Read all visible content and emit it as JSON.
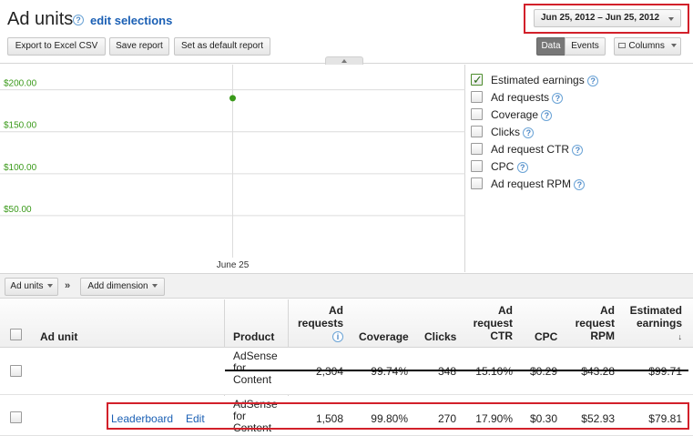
{
  "header": {
    "title": "Ad units",
    "edit_selections": "edit selections",
    "date_range": "Jun 25, 2012 – Jun 25, 2012"
  },
  "toolbar": {
    "export_label": "Export to Excel CSV",
    "save_label": "Save report",
    "default_label": "Set as default report",
    "data_label": "Data",
    "events_label": "Events",
    "columns_label": "Columns"
  },
  "metrics": [
    {
      "label": "Estimated earnings",
      "checked": true
    },
    {
      "label": "Ad requests",
      "checked": false
    },
    {
      "label": "Coverage",
      "checked": false
    },
    {
      "label": "Clicks",
      "checked": false
    },
    {
      "label": "Ad request CTR",
      "checked": false
    },
    {
      "label": "CPC",
      "checked": false
    },
    {
      "label": "Ad request RPM",
      "checked": false
    }
  ],
  "dimensions": {
    "ad_units_label": "Ad units",
    "chevron": "»",
    "add_dimension_label": "Add dimension"
  },
  "table": {
    "headers": {
      "ad_unit": "Ad unit",
      "product": "Product",
      "ad_requests": [
        "Ad",
        "requests"
      ],
      "coverage": "Coverage",
      "clicks": "Clicks",
      "ctr": [
        "Ad",
        "request",
        "CTR"
      ],
      "cpc": "CPC",
      "rpm": [
        "Ad",
        "request",
        "RPM"
      ],
      "earnings": [
        "Estimated",
        "earnings"
      ]
    },
    "rows": [
      {
        "ad_unit": "",
        "edit": "",
        "product": [
          "AdSense",
          "for",
          "Content"
        ],
        "ad_requests": "2,304",
        "coverage": "99.74%",
        "clicks": "348",
        "ctr": "15.10%",
        "cpc": "$0.29",
        "rpm": "$43.28",
        "earnings": "$99.71"
      },
      {
        "ad_unit": "Leaderboard",
        "edit": "Edit",
        "product": [
          "AdSense",
          "for",
          "Content"
        ],
        "ad_requests": "1,508",
        "coverage": "99.80%",
        "clicks": "270",
        "ctr": "17.90%",
        "cpc": "$0.30",
        "rpm": "$52.93",
        "earnings": "$79.81"
      }
    ]
  },
  "chart_data": {
    "type": "line",
    "title": "",
    "xlabel": "",
    "ylabel": "",
    "x": [
      "June 25"
    ],
    "series": [
      {
        "values": [
          190
        ],
        "color": "#3a9a1a"
      }
    ],
    "ylim": [
      0,
      230
    ],
    "yticks": [
      50,
      100,
      150,
      200
    ],
    "ytick_labels": [
      "$50.00",
      "$100.00",
      "$150.00",
      "$200.00"
    ],
    "grid": true
  },
  "colors": {
    "accent": "#1a5fb4",
    "highlight_box": "#d2202a",
    "series": "#3a9a1a"
  }
}
